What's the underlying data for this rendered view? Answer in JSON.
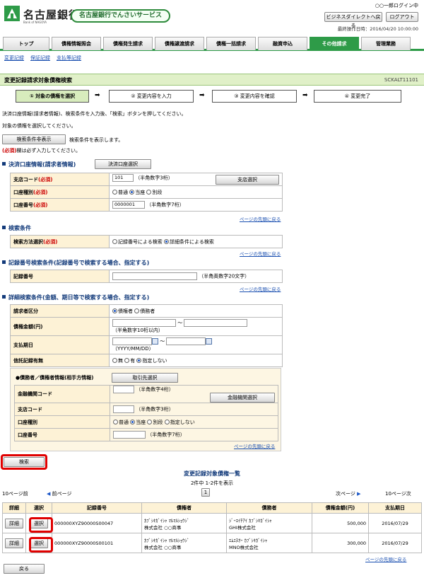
{
  "header": {
    "bank_name": "名古屋銀行",
    "bank_sub": "Bank of NAGOYA",
    "service": "名古屋銀行でんさいサービス",
    "user": "○○一郎ログイン中",
    "btn_direct": "ビジネスダイレクトへ戻る",
    "btn_logout": "ログアウト",
    "last_op": "最終操作日時：2016/04/20 10:00:00"
  },
  "nav": {
    "tabs": [
      "トップ",
      "債権情報照会",
      "債権発生請求",
      "債権譲渡請求",
      "債権一括請求",
      "融資申込",
      "その他請求",
      "管理業務"
    ]
  },
  "subnav": [
    "変更記録",
    "保証記録",
    "支払等記録"
  ],
  "page": {
    "title": "変更記録請求対象債権検索",
    "code": "SCKALT11101"
  },
  "steps": [
    "① 対象の債権を選択",
    "② 変更内容を入力",
    "③ 変更内容を確認",
    "④ 変更完了"
  ],
  "instr1": "決済口座情報(請求者情報)、検索条件を入力後、「検索」ボタンを押してください。",
  "instr2": "対象の債権を選択してください。",
  "toggle_btn": "検索条件非表示",
  "toggle_note": "検索条件を表示します。",
  "req_mark": "(必須)",
  "req_note": "欄は必ず入力してください。",
  "acct": {
    "title": "決済口座情報(請求者情報)",
    "select_btn": "決済口座選択",
    "branch_label": "支店コード",
    "branch_value": "101",
    "branch_hint": "（半角数字3桁）",
    "branch_btn": "支店選択",
    "type_label": "口座種別",
    "type_opts": [
      "普通",
      "当座",
      "別段"
    ],
    "num_label": "口座番号",
    "num_value": "0000001",
    "num_hint": "（半角数字7桁）"
  },
  "back_to_top": "ページの先頭に戻る",
  "search": {
    "title": "検索条件",
    "method_label": "検索方法選択",
    "method_opts": [
      "記録番号による検索",
      "詳細条件による検索"
    ]
  },
  "recno": {
    "title": "記録番号検索条件(記録番号で検索する場合、指定する)",
    "label": "記録番号",
    "hint": "（半角英数字20文字）"
  },
  "detail": {
    "title": "詳細検索条件(金額、期日等で検索する場合、指定する)",
    "req_label": "請求者区分",
    "req_opts": [
      "債権者",
      "債務者"
    ],
    "amount_label": "債権金額(円)",
    "amount_hint": "（半角数字10桁以内）",
    "tilde": "〜",
    "due_label": "支払期日",
    "due_hint": "（YYYY/MM/DD）",
    "trust_label": "信託記録有無",
    "trust_opts": [
      "無",
      "有",
      "指定しない"
    ]
  },
  "party": {
    "title": "●債務者／債権者情報(相手方情報)",
    "select_btn": "取引先選択",
    "bank_label": "金融機関コード",
    "bank_hint": "（半角数字4桁）",
    "bank_btn": "金融機関選択",
    "branch_label": "支店コード",
    "branch_hint": "（半角数字3桁）",
    "type_label": "口座種別",
    "type_opts": [
      "普通",
      "当座",
      "別段",
      "指定しない"
    ],
    "num_label": "口座番号",
    "num_hint": "（半角数字7桁）"
  },
  "search_btn": "検索",
  "results": {
    "title": "変更記録対象債権一覧",
    "count": "2件中 1-2件を表示",
    "prev10": "10ページ前",
    "prev": "前ページ",
    "page": "1",
    "next": "次ページ",
    "next10": "10ページ次",
    "headers": [
      "詳細",
      "選択",
      "記録番号",
      "債権者",
      "債務者",
      "債権金額(円)",
      "支払期日"
    ],
    "rows": [
      {
        "detail": "詳細",
        "select": "選択",
        "no": "000000XYZ90000S00047",
        "creditor_kana": "ｶﾌﾞｼｷｶﾞｲｼｬ ﾏﾙﾏﾙｼｮｳｼﾞ",
        "creditor": "株式会社 ○○商事",
        "debtor_kana": "ｼﾞｰｴｲﾁｱｲ ｶﾌﾞｼｷｶﾞｲｼｬ",
        "debtor": "GHI株式会社",
        "amount": "500,000",
        "due": "2016/07/29"
      },
      {
        "detail": "詳細",
        "select": "選択",
        "no": "000000XYZ90000S00101",
        "creditor_kana": "ｶﾌﾞｼｷｶﾞｲｼｬ ﾏﾙﾏﾙｼｮｳｼﾞ",
        "creditor": "株式会社 ○○商事",
        "debtor_kana": "ｴﾑｴﾇｵｰ ｶﾌﾞｼｷｶﾞｲｼｬ",
        "debtor": "MNO株式会社",
        "amount": "300,000",
        "due": "2016/07/29"
      }
    ]
  },
  "back_btn": "戻る",
  "colors": {
    "accent": "#2e9b48",
    "title_bg": "#e0f0c8",
    "label_bg": "#fdf2d6",
    "highlight": "#e00000"
  }
}
